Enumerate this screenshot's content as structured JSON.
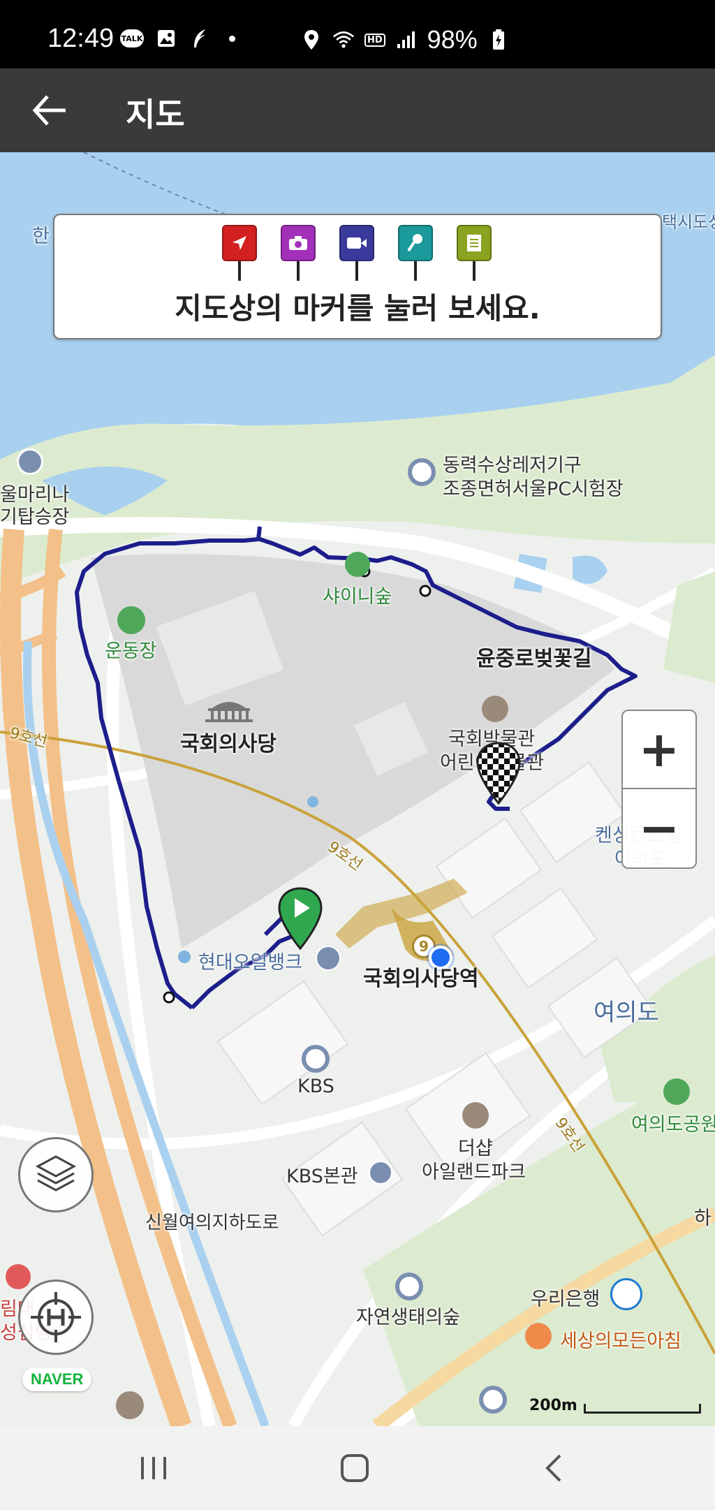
{
  "status_bar": {
    "time": "12:49",
    "battery": "98%",
    "hd": "HD",
    "talk": "TALK",
    "icons": [
      "talk-icon",
      "gallery-icon",
      "feather-icon",
      "location-icon",
      "wifi-icon",
      "signal-icon",
      "battery-charging-icon"
    ]
  },
  "appbar": {
    "title": "지도"
  },
  "banner": {
    "message": "지도상의 마커를 눌러 보세요.",
    "markers": [
      {
        "name": "navigation-marker",
        "color": "#d32020"
      },
      {
        "name": "camera-marker",
        "color": "#a230b8"
      },
      {
        "name": "video-marker",
        "color": "#3a3a9c"
      },
      {
        "name": "microphone-marker",
        "color": "#1a9a9a"
      },
      {
        "name": "memo-marker",
        "color": "#8aa320"
      }
    ]
  },
  "map": {
    "labels": {
      "han": "한",
      "taxi": "택시도성",
      "marina": "울마리나",
      "marina2": "기탑승장",
      "power_boat": "동력수상레저기구",
      "power_boat2": "조종면허서울PC시험장",
      "shiny_forest": "샤이니숲",
      "sports_field": "운동장",
      "cherry_road": "윤중로벚꽃길",
      "assembly": "국회의사당",
      "museum": "국회박물관",
      "museum2": "어린이박물관",
      "kensington": "켄싱턴호텔",
      "kensington2": "여의도",
      "line9_a": "9호선",
      "line9_b": "9호선",
      "line9_c": "9호선",
      "hyundai_bank": "현대오일뱅크",
      "assembly_station": "국회의사당역",
      "yeouido": "여의도",
      "yeouido_park": "여의도공원",
      "kbs": "KBS",
      "the_shop": "더샵",
      "island_park": "아일랜드파크",
      "kbs_hall": "KBS본관",
      "singil_underpass": "신월여의지하도로",
      "ha": "하",
      "hospital": "림대",
      "hospital2": "성심병",
      "nature_forest": "자연생태의숲",
      "woori_bank": "우리은행",
      "world_morning": "세상의모든아침"
    },
    "naver": "NAVER",
    "scale": "200m",
    "route_color": "#1c1e8c",
    "zoom": {
      "plus": "+",
      "minus": "−"
    }
  },
  "colors": {
    "water": "#a9d0ef",
    "park": "#dcebcf",
    "road": "#ffffff",
    "highway": "#f3c089",
    "line9": "#c9a23a",
    "assembly_area": "#d9d9d9"
  }
}
